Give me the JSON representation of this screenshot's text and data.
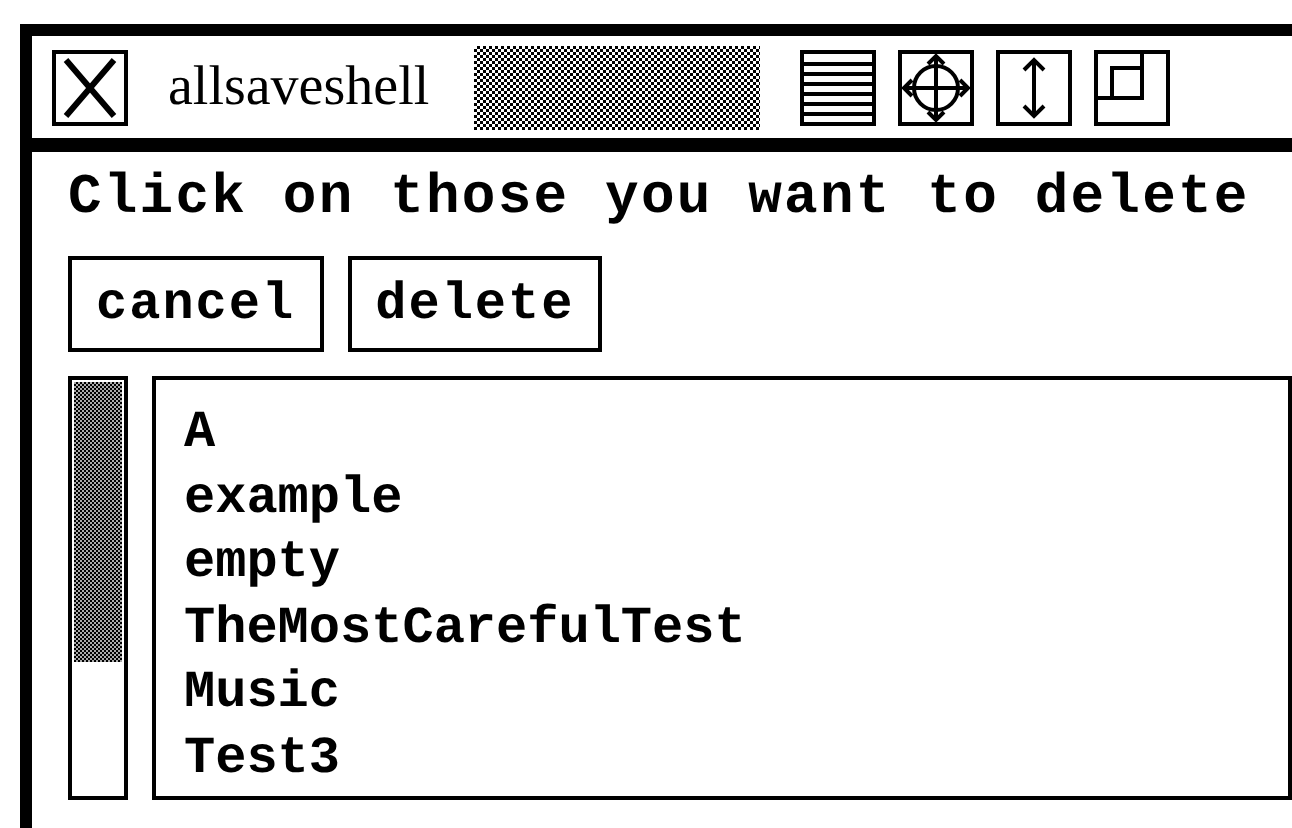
{
  "window": {
    "title": "allsaveshell"
  },
  "message": "Click on those you want to delete",
  "buttons": [
    "cancel",
    "delete"
  ],
  "list": {
    "items": [
      "A",
      "example",
      "empty",
      "TheMostCarefulTest",
      "Music",
      "Test3"
    ]
  }
}
